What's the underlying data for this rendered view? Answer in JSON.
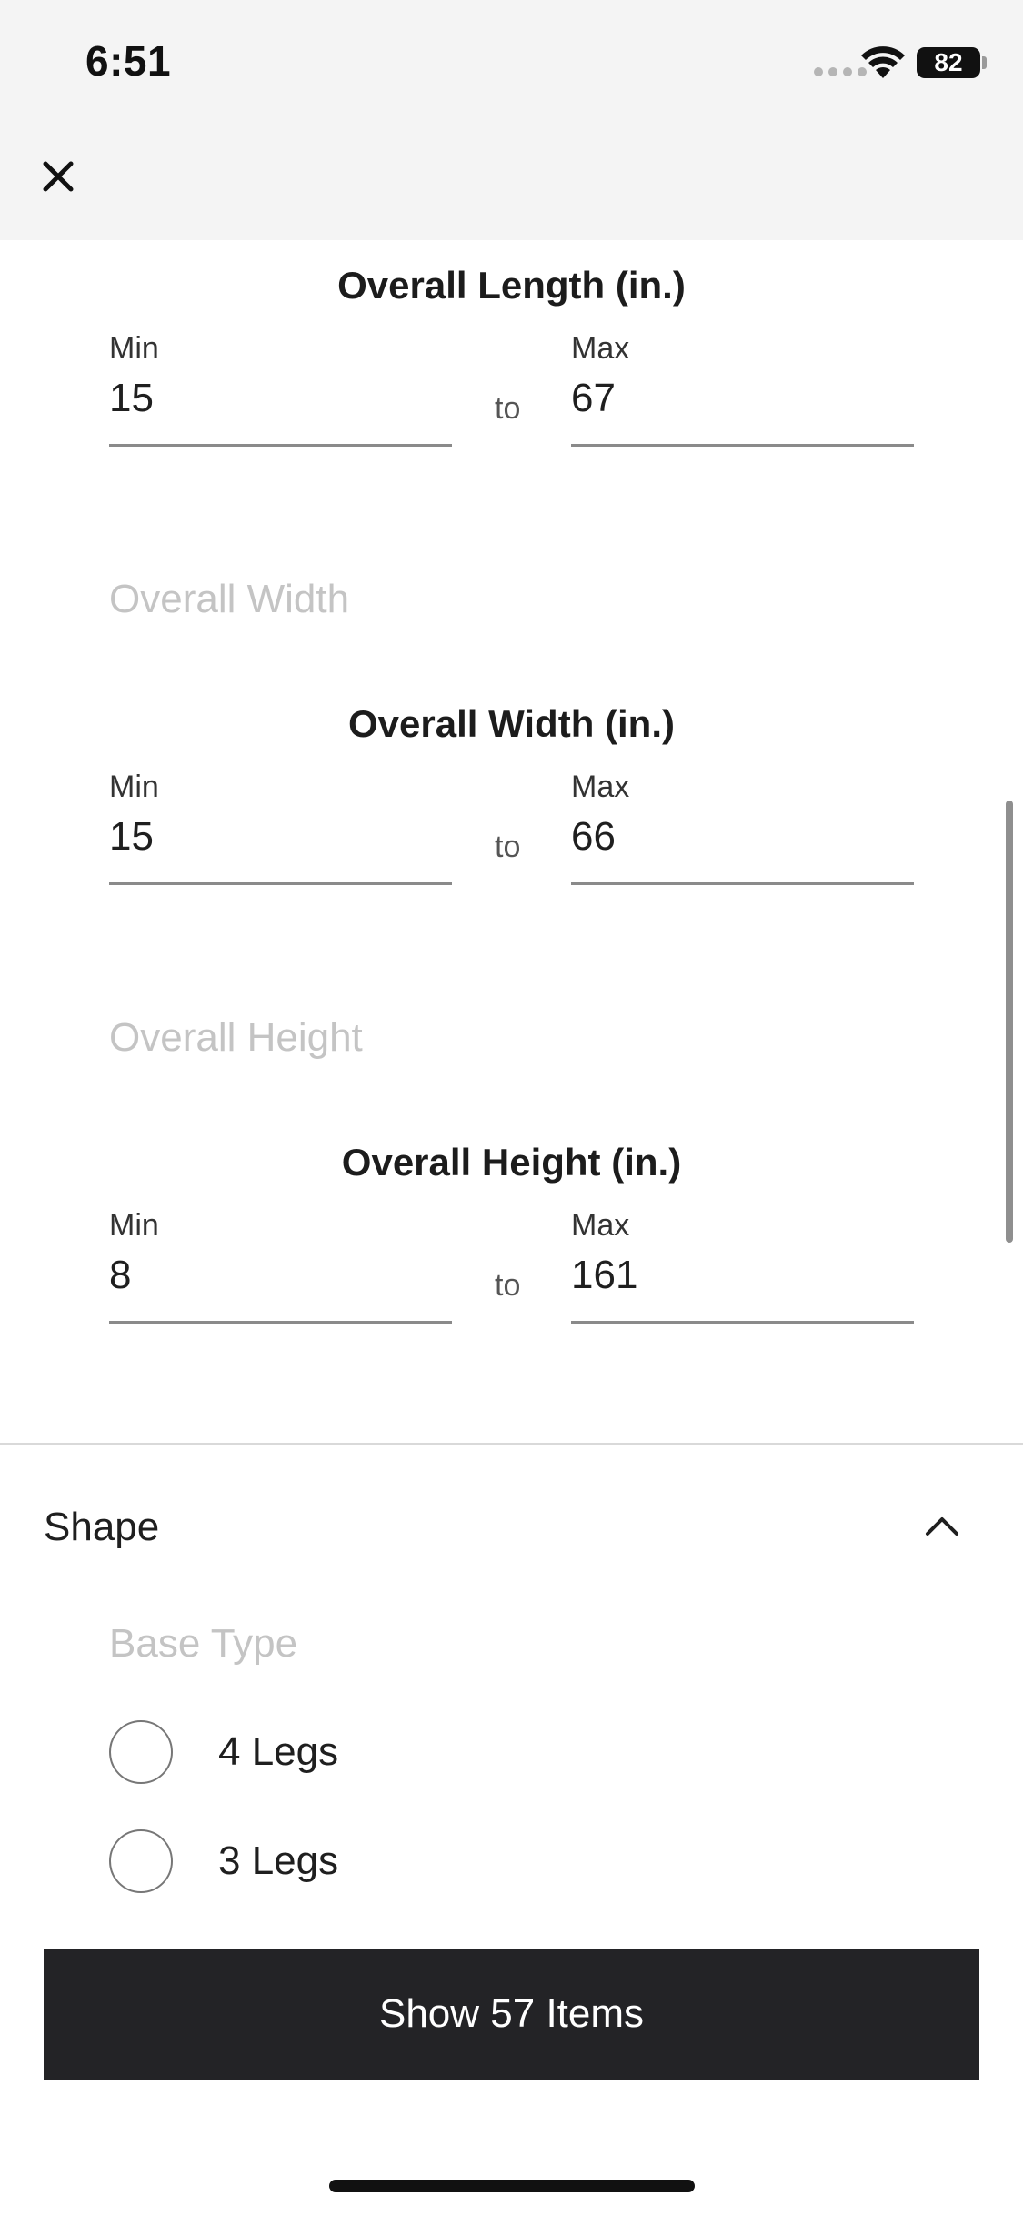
{
  "status_bar": {
    "time": "6:51",
    "battery": "82"
  },
  "dimensions": [
    {
      "title": "Overall Length (in.)",
      "min_label": "Min",
      "min_value": "15",
      "to": "to",
      "max_label": "Max",
      "max_value": "67"
    },
    {
      "subheading": "Overall Width",
      "title": "Overall Width (in.)",
      "min_label": "Min",
      "min_value": "15",
      "to": "to",
      "max_label": "Max",
      "max_value": "66"
    },
    {
      "subheading": "Overall Height",
      "title": "Overall Height (in.)",
      "min_label": "Min",
      "min_value": "8",
      "to": "to",
      "max_label": "Max",
      "max_value": "161"
    }
  ],
  "shape_section": {
    "title": "Shape",
    "subheading": "Base Type",
    "options": [
      {
        "label": "4 Legs",
        "selected": false
      },
      {
        "label": "3 Legs",
        "selected": false
      }
    ]
  },
  "action": {
    "label": "Show 57 Items"
  }
}
